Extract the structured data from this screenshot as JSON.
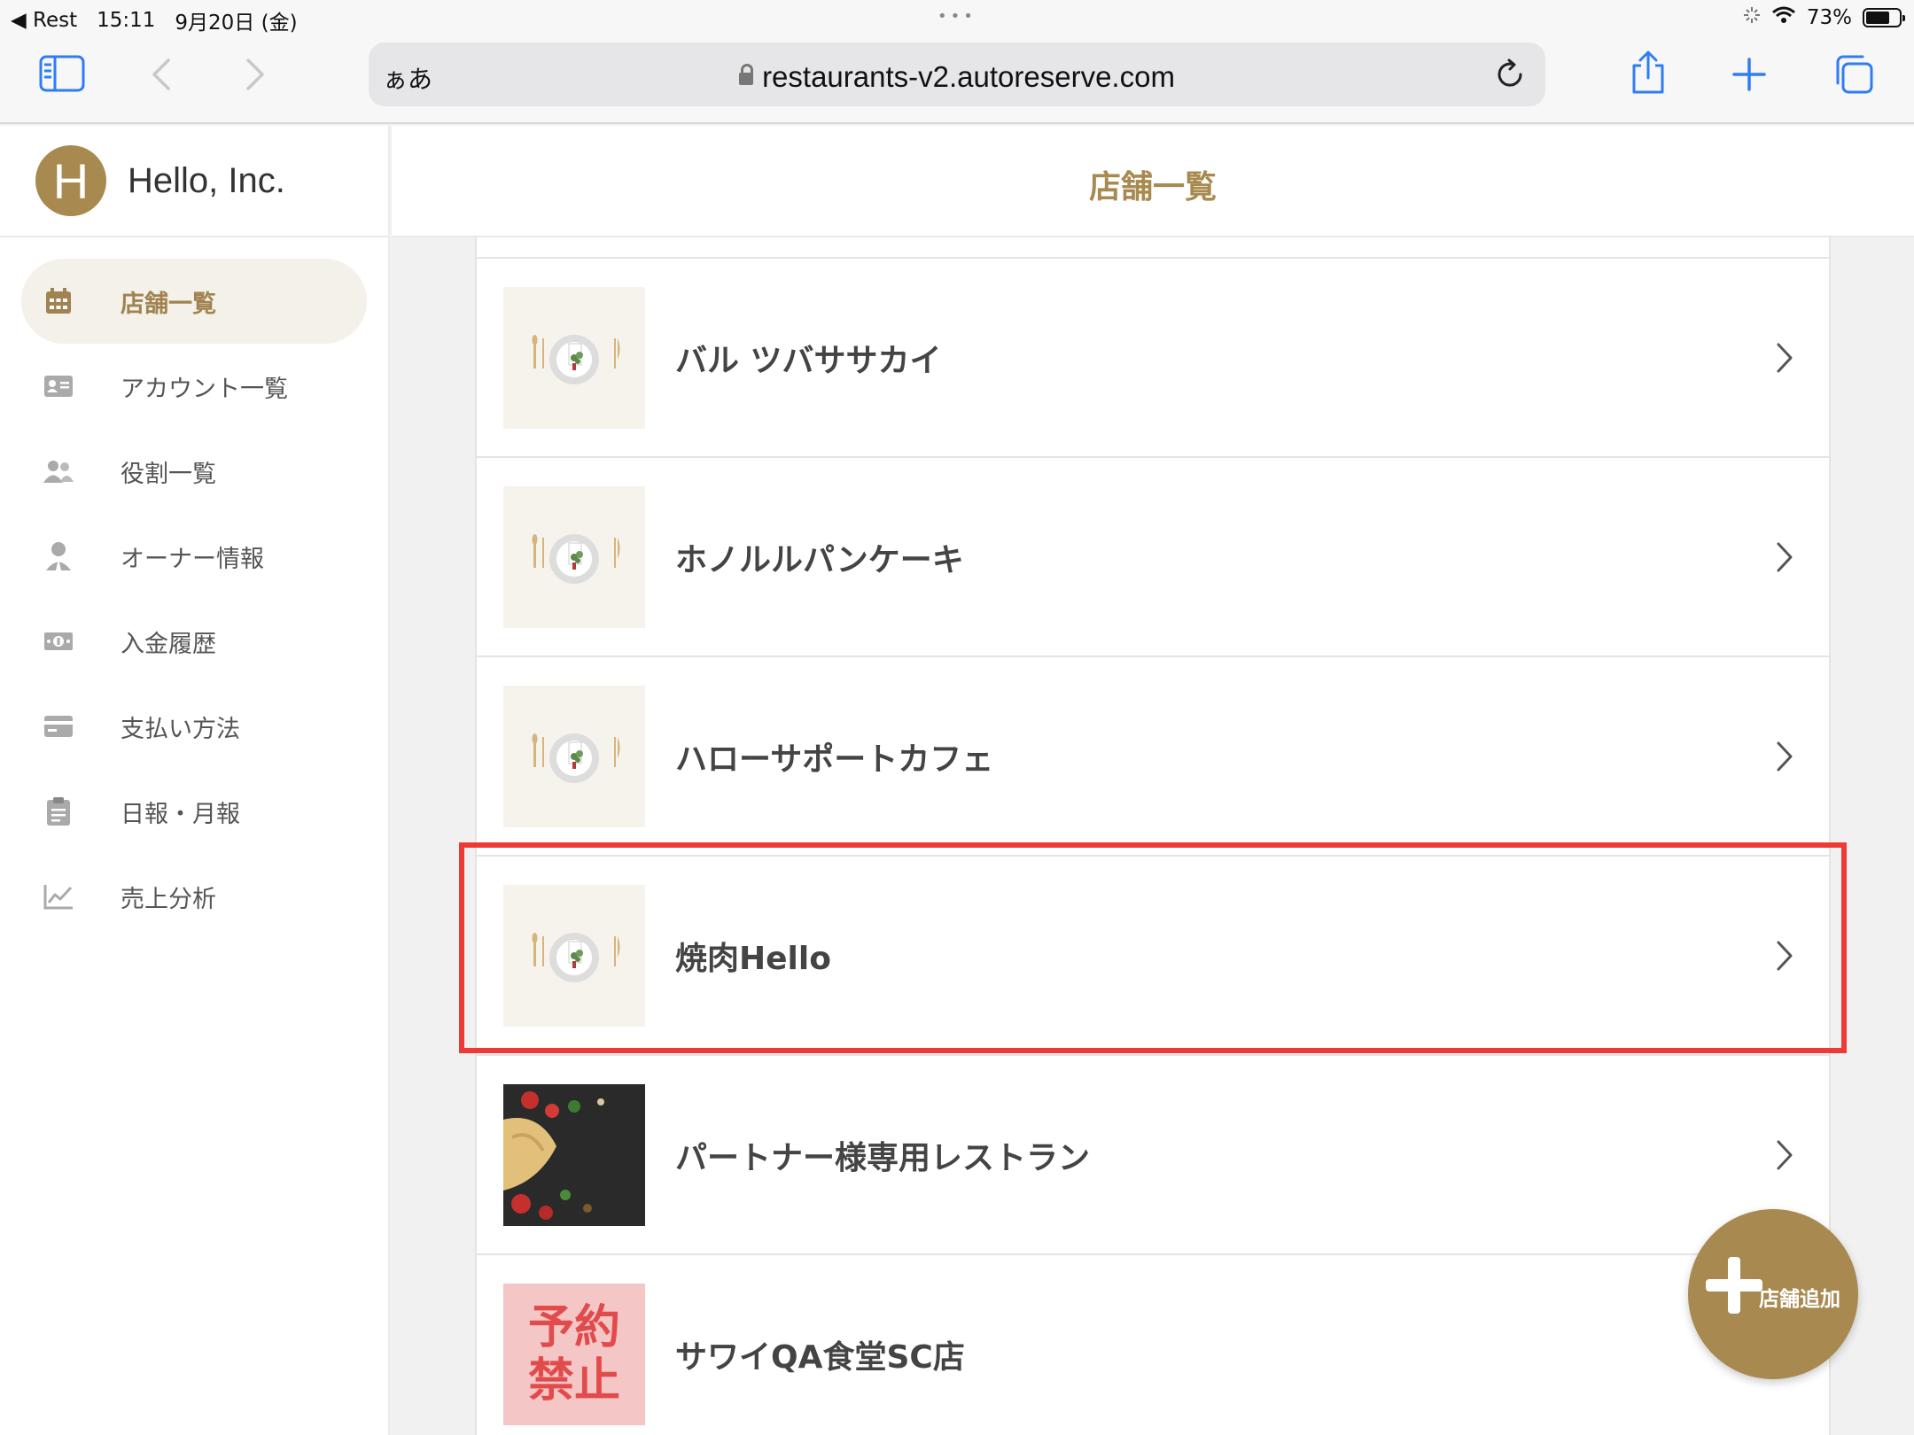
{
  "status_bar": {
    "back_app": "◀ Rest",
    "time": "15:11",
    "date": "9月20日 (金)",
    "dots": "•••",
    "battery": "73%"
  },
  "browser": {
    "aa_label": "ぁあ",
    "url": "restaurants-v2.autoreserve.com"
  },
  "sidebar": {
    "avatar_letter": "H",
    "company": "Hello, Inc.",
    "items": [
      {
        "label": "店舗一覧",
        "icon": "calendar-icon",
        "active": true
      },
      {
        "label": "アカウント一覧",
        "icon": "id-card-icon",
        "active": false
      },
      {
        "label": "役割一覧",
        "icon": "users-icon",
        "active": false
      },
      {
        "label": "オーナー情報",
        "icon": "user-tie-icon",
        "active": false
      },
      {
        "label": "入金履歴",
        "icon": "money-icon",
        "active": false
      },
      {
        "label": "支払い方法",
        "icon": "credit-card-icon",
        "active": false
      },
      {
        "label": "日報・月報",
        "icon": "clipboard-icon",
        "active": false
      },
      {
        "label": "売上分析",
        "icon": "line-chart-icon",
        "active": false
      }
    ]
  },
  "main": {
    "title": "店舗一覧",
    "restaurants": [
      {
        "name": "バル ツバササカイ",
        "thumb": "placeholder"
      },
      {
        "name": "ホノルルパンケーキ",
        "thumb": "placeholder"
      },
      {
        "name": "ハローサポートカフェ",
        "thumb": "placeholder"
      },
      {
        "name": "焼肉Hello",
        "thumb": "placeholder"
      },
      {
        "name": "パートナー様専用レストラン",
        "thumb": "food"
      },
      {
        "name": "サワイQA食堂SC店",
        "thumb": "blocked",
        "thumb_text": [
          "予約",
          "禁止"
        ]
      }
    ],
    "add_button": "店舗追加"
  },
  "colors": {
    "accent": "#a8894f",
    "highlight": "#ec3a36",
    "link_blue": "#2f7df6"
  }
}
